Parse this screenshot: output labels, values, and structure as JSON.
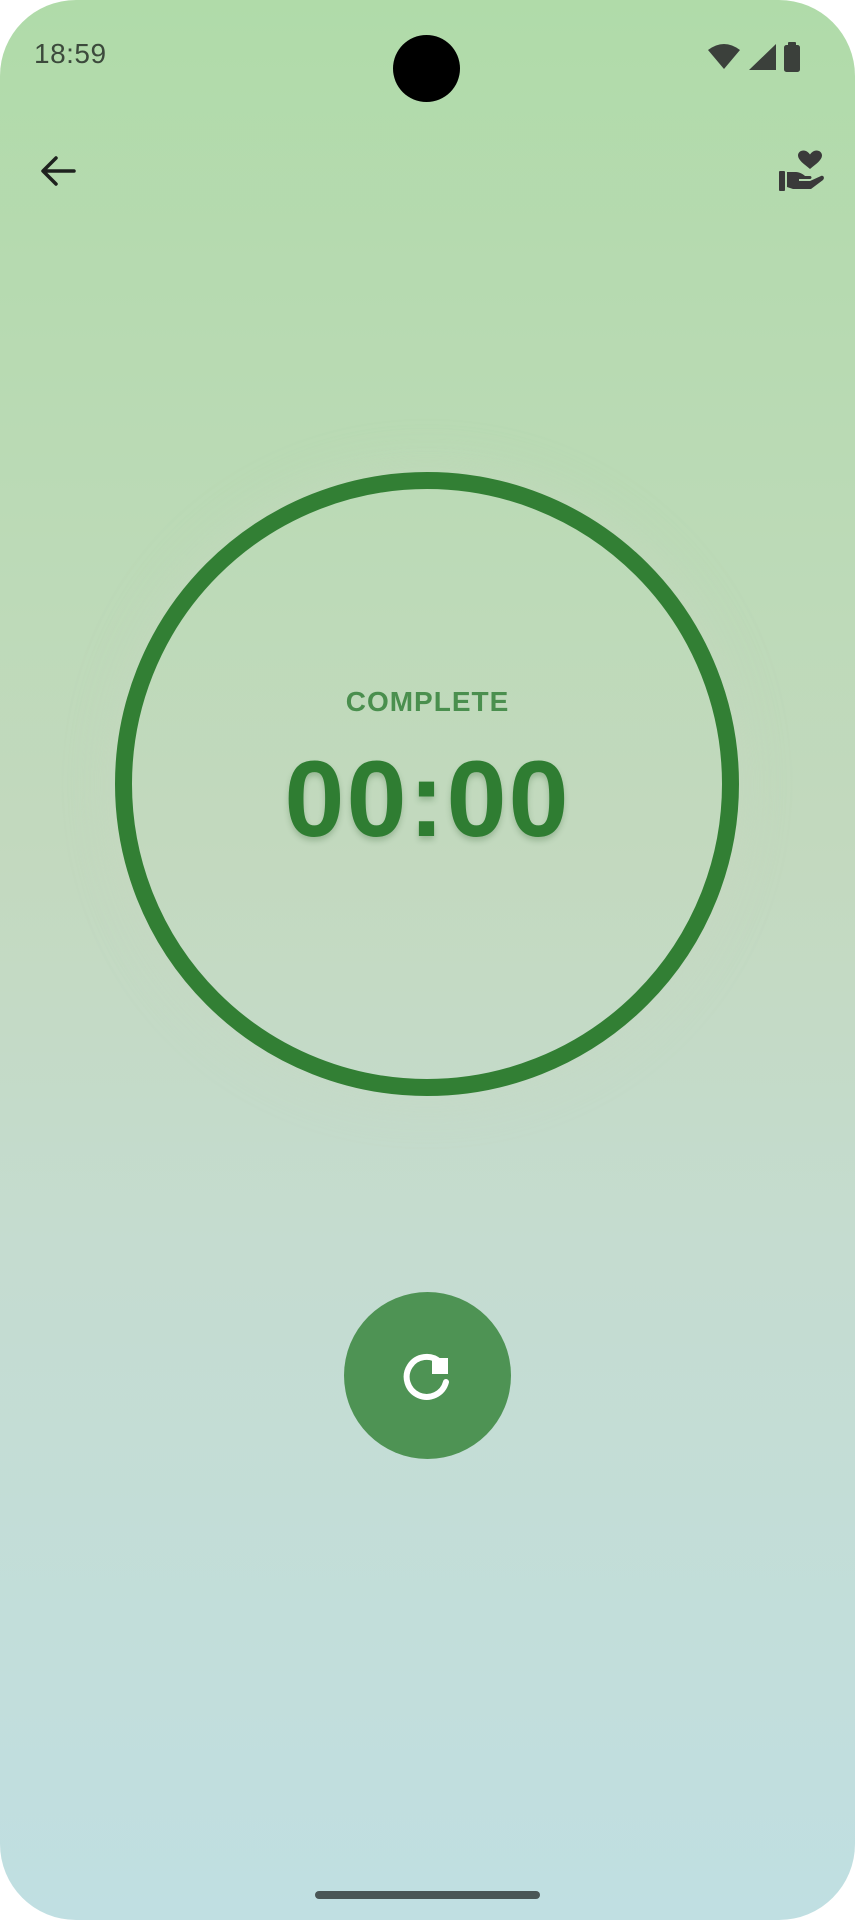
{
  "status_bar": {
    "time": "18:59",
    "icons": [
      "wifi-icon",
      "cellular-signal-icon",
      "battery-icon"
    ]
  },
  "toolbar": {
    "back_icon": "arrow-left-icon",
    "support_icon": "hand-heart-icon"
  },
  "timer": {
    "status_label": "COMPLETE",
    "value": "00:00",
    "progress": 1.0
  },
  "controls": {
    "reset_icon": "restart-icon"
  },
  "colors": {
    "accent": "#327f34",
    "button": "#4e9354",
    "status_text": "#4a8f4e",
    "gradient_top": "#b0dba9",
    "gradient_bottom": "#c0dfe2"
  }
}
